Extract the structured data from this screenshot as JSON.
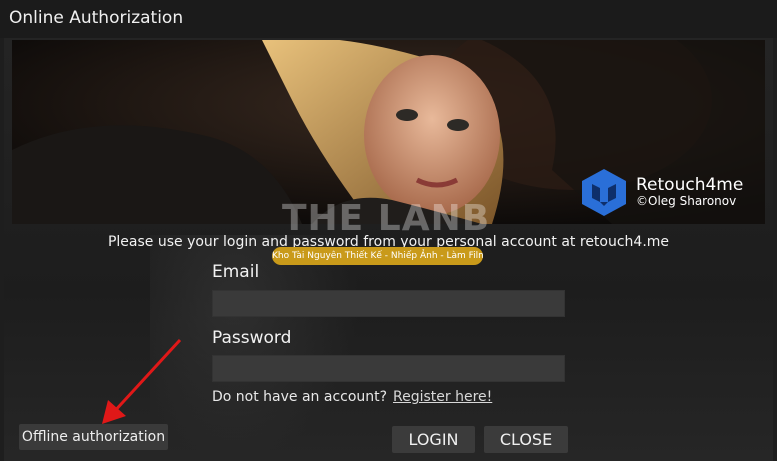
{
  "window": {
    "title": "Online Authorization"
  },
  "banner": {
    "logo_name": "Retouch4me",
    "logo_sub": "©Oleg Sharonov",
    "watermark_text": "THE LANB",
    "watermark_badge": "Kho Tài Nguyên Thiết Kế - Nhiếp Ảnh - Làm Film"
  },
  "form": {
    "instruction": "Please use your login and password from your personal account at retouch4.me",
    "email_label": "Email",
    "email_value": "",
    "password_label": "Password",
    "password_value": "",
    "no_account_text": "Do not have an account?",
    "register_link": "Register here!"
  },
  "buttons": {
    "offline": "Offline authorization",
    "login": "LOGIN",
    "close": "CLOSE"
  },
  "colors": {
    "background": "#1e1e1e",
    "button": "#3b3b3b",
    "arrow": "#e01818",
    "logo_blue": "#2a6fd8",
    "watermark_badge": "#c99a1a"
  }
}
